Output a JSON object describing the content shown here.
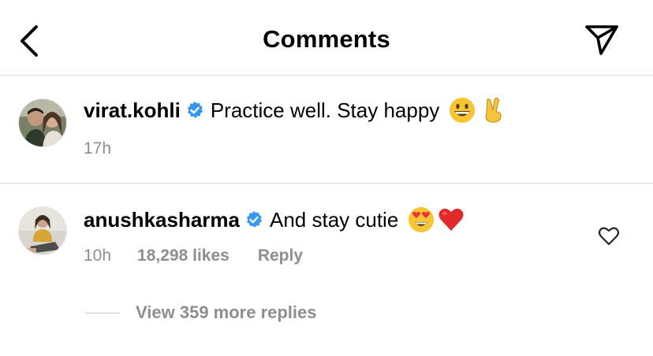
{
  "header": {
    "title": "Comments",
    "back_icon": "chevron-left-icon",
    "send_icon": "paper-plane-icon"
  },
  "caption": {
    "username": "virat.kohli",
    "verified": true,
    "text": "Practice well. Stay happy",
    "emojis": [
      "grinning-face-emoji",
      "victory-hand-emoji"
    ],
    "time": "17h"
  },
  "comment": {
    "username": "anushkasharma",
    "verified": true,
    "text": "And stay cutie",
    "emojis": [
      "heart-eyes-emoji",
      "red-heart-emoji"
    ],
    "time": "10h",
    "likes": "18,298 likes",
    "reply_label": "Reply",
    "like_icon": "heart-outline-icon"
  },
  "replies": {
    "label": "View 359 more replies"
  },
  "colors": {
    "verified_blue": "#3897f0",
    "meta_gray": "#8e8e8e",
    "divider": "#dbdbdb"
  }
}
